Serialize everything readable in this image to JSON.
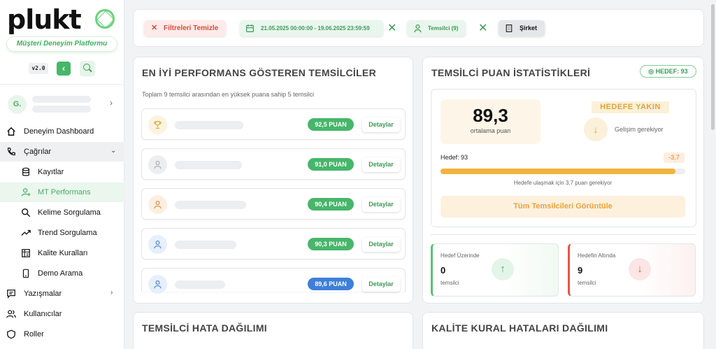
{
  "brand": {
    "name": "plukt",
    "tagline": "Müşteri Deneyim Platformu",
    "version": "v2.0",
    "accent": "#47b66a"
  },
  "user": {
    "initial": "G."
  },
  "nav": [
    {
      "label": "Deneyim Dashboard",
      "icon": "home-icon"
    },
    {
      "label": "Çağrılar",
      "icon": "phone-icon",
      "expanded": true
    },
    {
      "label": "Kayıtlar",
      "icon": "database-icon",
      "sub": true
    },
    {
      "label": "MT Performans",
      "icon": "user-plus-icon",
      "sub": true,
      "active": true
    },
    {
      "label": "Kelime Sorgulama",
      "icon": "search-icon",
      "sub": true
    },
    {
      "label": "Trend Sorgulama",
      "icon": "trend-icon",
      "sub": true
    },
    {
      "label": "Kalite Kuralları",
      "icon": "rules-icon",
      "sub": true
    },
    {
      "label": "Demo Arama",
      "icon": "mobile-icon",
      "sub": true
    },
    {
      "label": "Yazışmalar",
      "icon": "chat-icon",
      "has_children": true
    },
    {
      "label": "Kullanıcılar",
      "icon": "users-icon"
    },
    {
      "label": "Roller",
      "icon": "shield-icon"
    }
  ],
  "filters": {
    "clear_label": "Filtreleri Temizle",
    "date_range": "21.05.2025 00:00:00 - 19.06.2025 23:59:59",
    "reps": "Temsilci (9)",
    "company": "Şirket"
  },
  "top_performers": {
    "title": "EN İYİ PERFORMANS GÖSTEREN TEMSİLCİLER",
    "subtitle": "Toplam 9 temsilci arasından en yüksek puana sahip 5 temsilci",
    "detail_label": "Detaylar",
    "items": [
      {
        "score": "92,5 PUAN",
        "icon": "trophy-icon",
        "color": "#47b66a"
      },
      {
        "score": "91,0 PUAN",
        "icon": "user-icon",
        "color": "#47b66a"
      },
      {
        "score": "90,4 PUAN",
        "icon": "user-icon",
        "color": "#47b66a"
      },
      {
        "score": "90,3 PUAN",
        "icon": "user-icon",
        "color": "#47b66a"
      },
      {
        "score": "89,6 PUAN",
        "icon": "user-icon",
        "color": "#3d7fd9"
      }
    ]
  },
  "stats": {
    "title": "TEMSİLCİ PUAN İSTATİSTİKLERİ",
    "target_badge": "HEDEF: 93",
    "average": "89,3",
    "average_label": "ortalama puan",
    "status": "HEDEFE YAKIN",
    "status_note": "Gelişim gerekiyor",
    "target_label": "Hedef: 93",
    "difference": "-3,7",
    "progress": 0.96,
    "progress_note": "Hedefe ulaşmak için 3,7 puan gerekiyor",
    "all_button": "Tüm Temsilcileri Görüntüle",
    "above": {
      "label": "Hedef Üzerinde",
      "value": "0",
      "unit": "temsilci"
    },
    "below": {
      "label": "Hedefin Altında",
      "value": "9",
      "unit": "temsilci"
    }
  },
  "error_distribution": {
    "title": "TEMSİLCİ HATA DAĞILIMI"
  },
  "quality_errors": {
    "title": "KALİTE KURAL HATALARI DAĞILIMI"
  }
}
